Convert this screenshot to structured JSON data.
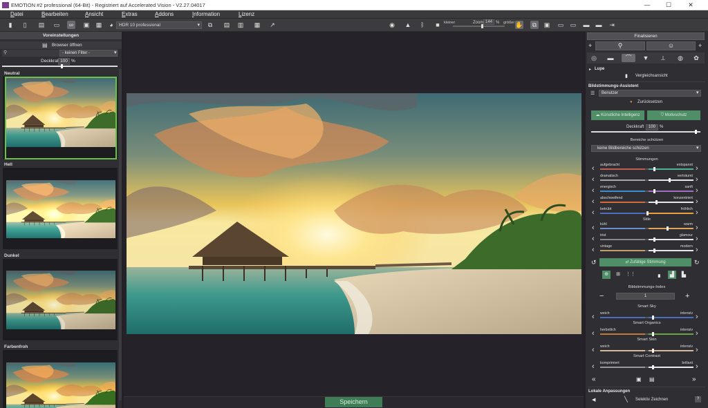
{
  "window": {
    "title": "EMOTION #2 professional (64-Bit) - Registriert auf Accelerated Vision - V2.27.04017",
    "minimize": "—",
    "maximize": "☐",
    "close": "✕"
  },
  "menu": [
    "Datei",
    "Bearbeiten",
    "Ansicht",
    "Extras",
    "Addons",
    "Information",
    "Lizenz"
  ],
  "toolbar": {
    "preset": "HDR 10 professional",
    "zoom_label": "Zoom",
    "zoom_value": "144",
    "zoom_unit": "%",
    "smaller": "kleiner",
    "larger": "größer"
  },
  "left": {
    "header": "Voreinstellungen",
    "browser_button": "Browser öffnen",
    "filter_value": "- keinen Filter -",
    "opacity_label": "Deckkraft",
    "opacity_value": "100",
    "opacity_unit": "%",
    "categories": [
      "Neutral",
      "Hell",
      "Dunkel",
      "Farbenfroh"
    ]
  },
  "center": {
    "save_label": "Speichern"
  },
  "right": {
    "finalize": "Finalisieren",
    "lupe": "Lupe",
    "compare": "Vergleichsansicht",
    "assistant_title": "Bildstimmungs-Assistent",
    "user_value": "Benutzer",
    "reset": "Zurücksetzen",
    "ai_button": "Künstliche Intelligenz",
    "motif_button": "Motivschutz",
    "opacity_label": "Deckkraft",
    "opacity_value": "100",
    "opacity_unit": "%",
    "protect_title": "Bereiche schützen",
    "protect_value": "keine Bildbereiche schützen",
    "moods_title": "Stimmungen",
    "moods": [
      {
        "left": "aufgebracht",
        "right": "entspannt",
        "value": 0.58,
        "lc": "#c25e55",
        "rc": "#4db29a"
      },
      {
        "left": "dramatisch",
        "right": "verträumt",
        "value": 0.74,
        "lc": "#a8a8a8",
        "rc": "#e8e8e8"
      },
      {
        "left": "energisch",
        "right": "sanft",
        "value": 0.58,
        "lc": "#3f8fcf",
        "rc": "#a06fc0"
      },
      {
        "left": "abschweifend",
        "right": "konzentriert",
        "value": 0.6,
        "lc": "#d06c40",
        "rc": "#e8e8e8"
      },
      {
        "left": "betrübt",
        "right": "fröhlich",
        "value": 0.5,
        "lc": "#4f6ec4",
        "rc": "#e8a23d"
      }
    ],
    "styles_title": "Stile",
    "styles": [
      {
        "left": "kühl",
        "right": "warm",
        "value": 0.72,
        "lc": "#6b8ed1",
        "rc": "#e2a35a"
      },
      {
        "left": "trist",
        "right": "glamour",
        "value": 0.58,
        "lc": "#888888",
        "rc": "#e8e8e8"
      },
      {
        "left": "vintage",
        "right": "modern",
        "value": 0.58,
        "lc": "#c3a06a",
        "rc": "#e8e8e8"
      }
    ],
    "random_button": "Zufällige Stimmung",
    "index_title": "Bildstimmungs-Index",
    "index_value": "1",
    "minus": "−",
    "plus": "+",
    "smart": [
      {
        "title": "Smart Sky",
        "left": "weich",
        "right": "intensiv",
        "value": 0.56,
        "lc": "#4a6fc2",
        "rc": "#4a6fc2"
      },
      {
        "title": "Smart Organics",
        "left": "herbstlich",
        "right": "intensiv",
        "value": 0.56,
        "lc": "#c07a3a",
        "rc": "#6aa548"
      },
      {
        "title": "Smart Skin",
        "left": "weich",
        "right": "intensiv",
        "value": 0.56,
        "lc": "#d9b89a",
        "rc": "#d9b89a"
      },
      {
        "title": "Smart Contrast",
        "left": "komprimiert",
        "right": "brillant",
        "value": 0.56,
        "lc": "#9a9a9a",
        "rc": "#e8e8e8"
      }
    ],
    "local_title": "Lokale Anpassungen",
    "selective_draw": "Selektiv Zeichnen"
  }
}
